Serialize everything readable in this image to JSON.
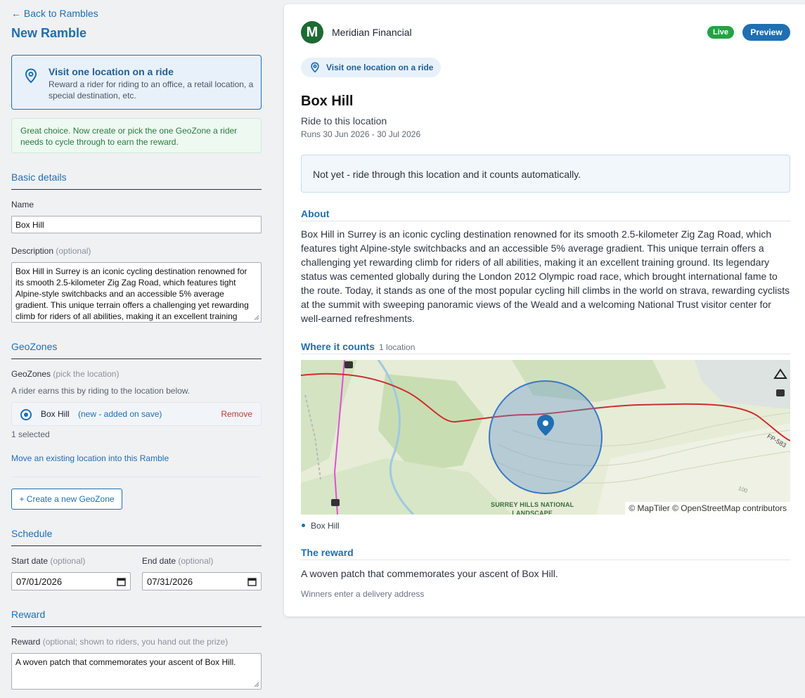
{
  "nav": {
    "back_label": "← Back to Rambles",
    "page_title": "New Ramble"
  },
  "type_card": {
    "icon": "location-pin-icon",
    "title": "Visit one location on a ride",
    "description": "Reward a rider for riding to an office, a retail location, a special destination, etc."
  },
  "notice": "Great choice. Now create or pick the one GeoZone a rider needs to cycle through to earn the reward.",
  "basic": {
    "heading": "Basic details",
    "name_label": "Name",
    "name_value": "Box Hill",
    "description_label": "Description",
    "description_optional": "(optional)",
    "description_value": "Box Hill in Surrey is an iconic cycling destination renowned for its smooth 2.5-kilometer Zig Zag Road, which features tight Alpine-style switchbacks and an accessible 5% average gradient. This unique terrain offers a challenging yet rewarding climb for riders of all abilities, making it an excellent training"
  },
  "geozones": {
    "heading": "GeoZones",
    "label": "GeoZones",
    "label_optional": "(pick the location)",
    "help": "A rider earns this by riding to the location below.",
    "item_name": "Box Hill",
    "item_status": "(new - added on save)",
    "remove_label": "Remove",
    "selected_count": "1 selected",
    "move_link": "Move an existing location into this Ramble",
    "create_button": "+ Create a new GeoZone"
  },
  "schedule": {
    "heading": "Schedule",
    "start_label": "Start date",
    "start_optional": "(optional)",
    "start_value": "07/01/2026",
    "end_label": "End date",
    "end_optional": "(optional)",
    "end_value": "07/31/2026"
  },
  "reward_form": {
    "heading": "Reward",
    "label": "Reward",
    "label_optional": "(optional; shown to riders, you hand out the prize)",
    "value": "A woven patch that commemorates your ascent of Box Hill."
  },
  "preview": {
    "org_logo_letter": "M",
    "org_name": "Meridian Financial",
    "live_badge": "Live",
    "preview_button": "Preview",
    "type_pill": "Visit one location on a ride",
    "title": "Box Hill",
    "subtitle": "Ride to this location",
    "runs": "Runs 30 Jun 2026 - 30 Jul 2026",
    "status": "Not yet - ride through this location and it counts automatically.",
    "about_heading": "About",
    "about_text": "Box Hill in Surrey is an iconic cycling destination renowned for its smooth 2.5-kilometer Zig Zag Road, which features tight Alpine-style switchbacks and an accessible 5% average gradient. This unique terrain offers a challenging yet rewarding climb for riders of all abilities, making it an excellent training ground. Its legendary status was cemented globally during the London 2012 Olympic road race, which brought international fame to the route. Today, it stands as one of the most popular cycling hill climbs in the world on strava, rewarding cyclists at the summit with sweeping panoramic views of the Weald and a welcoming National Trust visitor center for well-earned refreshments.",
    "where_heading": "Where it counts",
    "where_count": "1 location",
    "map_label_line1": "SURREY HILLS NATIONAL",
    "map_label_line2": "LANDSCAPE",
    "map_road_label": "FP-583",
    "map_contour_label": "100",
    "map_attribution": "© MapTiler © OpenStreetMap contributors",
    "legend_item": "Box Hill",
    "reward_heading": "The reward",
    "reward_text": "A woven patch that commemorates your ascent of Box Hill.",
    "reward_note": "Winners enter a delivery address"
  },
  "colors": {
    "accent": "#1f6fb2",
    "live": "#25a244",
    "org_logo": "#1d6b33",
    "remove": "#c23a2e",
    "notice_text": "#2a7a3e"
  }
}
